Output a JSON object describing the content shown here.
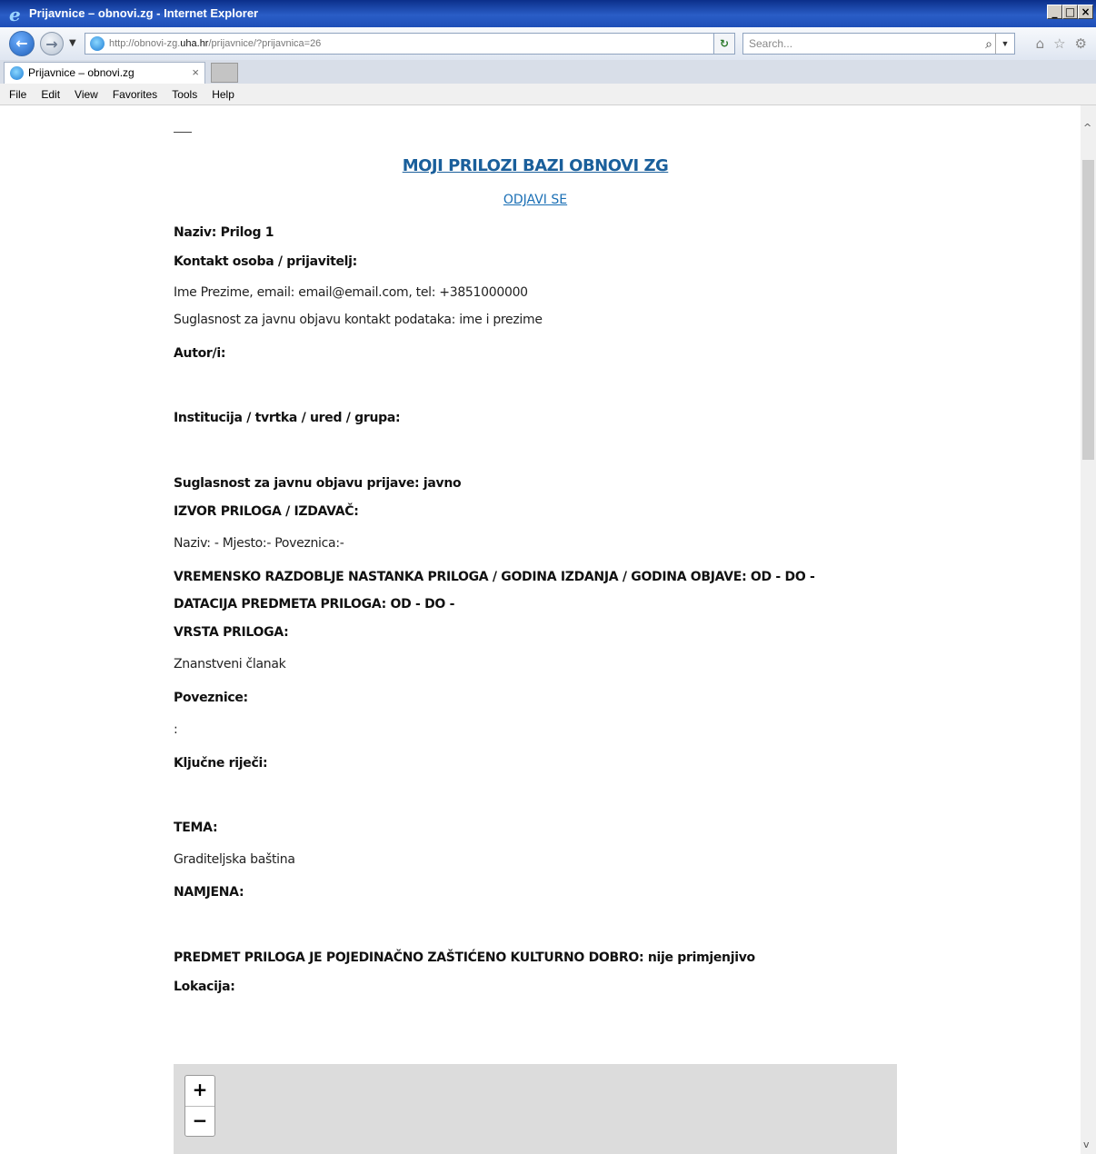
{
  "window": {
    "title": "Prijavnice – obnovi.zg - Internet Explorer",
    "buttons": [
      "_",
      "□",
      "×"
    ]
  },
  "address_bar": {
    "url_prefix": "http://obnovi-zg.",
    "url_domain": "uha.hr",
    "url_suffix": "/prijavnice/?prijavnica=26",
    "search_placeholder": "Search..."
  },
  "tab": {
    "label": "Prijavnice – obnovi.zg",
    "close": "×"
  },
  "menu": [
    "File",
    "Edit",
    "View",
    "Favorites",
    "Tools",
    "Help"
  ],
  "page": {
    "heading": "MOJI PRILOZI BAZI OBNOVI ZG",
    "logout": "ODJAVI SE",
    "rows": [
      {
        "text": "Naziv: Prilog 1",
        "bold": true
      },
      {
        "text": "Kontakt osoba / prijavitelj:",
        "bold": true
      },
      {
        "text": "Ime Prezime, email: email@email.com, tel: +3851000000",
        "bold": false
      },
      {
        "text": "Suglasnost za javnu objavu kontakt podataka: ime i prezime",
        "bold": false
      },
      {
        "text": "Autor/i:",
        "bold": true
      },
      {
        "text": "Institucija / tvrtka / ured / grupa:",
        "bold": true
      },
      {
        "text": "Suglasnost za javnu objavu prijave: javno",
        "bold": true
      },
      {
        "text": "IZVOR PRILOGA / IZDAVAČ:",
        "bold": true
      },
      {
        "text": "Naziv: - Mjesto:- Poveznica:-",
        "bold": false
      },
      {
        "text": "VREMENSKO RAZDOBLJE NASTANKA PRILOGA / GODINA IZDANJA / GODINA OBJAVE: OD - DO -",
        "bold": true
      },
      {
        "text": "DATACIJA PREDMETA PRILOGA: OD - DO -",
        "bold": true
      },
      {
        "text": "VRSTA PRILOGA:",
        "bold": true
      },
      {
        "text": "Znanstveni članak",
        "bold": false
      },
      {
        "text": "Poveznice:",
        "bold": true
      },
      {
        "text": ":",
        "bold": false
      },
      {
        "text": "Ključne riječi:",
        "bold": true
      },
      {
        "text": "TEMA:",
        "bold": true
      },
      {
        "text": "Graditeljska baština",
        "bold": false
      },
      {
        "text": "NAMJENA:",
        "bold": true
      },
      {
        "text": "PREDMET PRILOGA JE POJEDINAČNO ZAŠTIĆENO KULTURNO DOBRO: nije primjenjivo",
        "bold": true
      },
      {
        "text": "Lokacija:",
        "bold": true
      }
    ],
    "map": {
      "zoom_in": "+",
      "zoom_out": "−"
    }
  }
}
